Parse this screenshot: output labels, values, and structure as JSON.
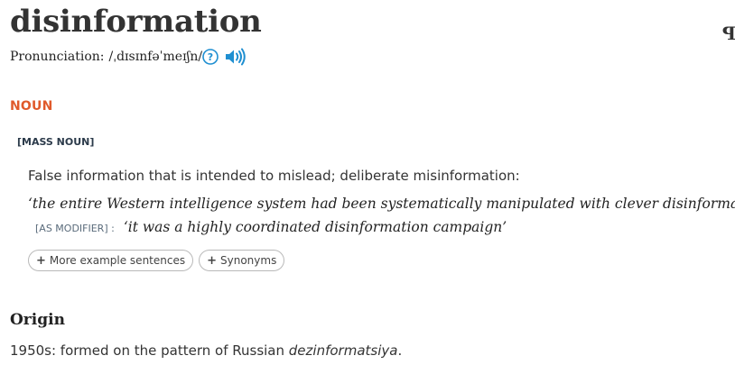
{
  "entry": {
    "headword": "disinformation",
    "corner_mark": "ꟼ",
    "pronunciation": {
      "label": "Pronunciation:",
      "ipa": "/ˌdɪsɪnfəˈmeɪʃn/",
      "help_icon": "question-circle-icon",
      "audio_icon": "speaker-icon"
    }
  },
  "sense": {
    "part_of_speech": "NOUN",
    "grammar_label": "[MASS NOUN]",
    "definition": "False information that is intended to mislead; deliberate misinformation:",
    "example_1": "‘the entire Western intelligence system had been systematically manipulated with clever disinformation’",
    "modifier_label": "[AS MODIFIER] :",
    "example_2": "‘it was a highly coordinated disinformation campaign’",
    "buttons": {
      "more_examples": "More example sentences",
      "synonyms": "Synonyms",
      "plus": "+"
    }
  },
  "origin": {
    "heading": "Origin",
    "text_prefix": "1950s: formed on the pattern of Russian ",
    "text_italic": "dezinformatsiya",
    "text_suffix": "."
  },
  "colors": {
    "accent": "#e05a2b",
    "link_blue": "#1f8fd1"
  }
}
